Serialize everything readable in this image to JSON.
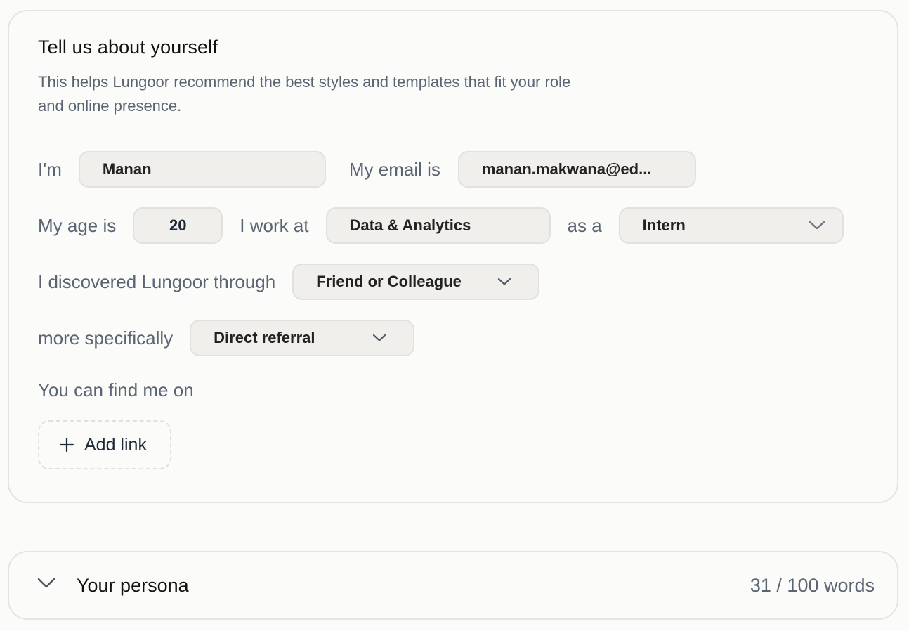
{
  "about": {
    "title": "Tell us about yourself",
    "description": "This helps Lungoor recommend the best styles and templates that fit your role and online presence.",
    "name_label": "I'm",
    "name_value": "Manan",
    "email_label": "My email is",
    "email_value": "manan.makwana@ed...",
    "age_label": "My age is",
    "age_value": "20",
    "work_label": "I work at",
    "work_value": "Data & Analytics",
    "role_label": "as a",
    "role_value": "Intern",
    "discover_label": "I discovered Lungoor through",
    "discover_value": "Friend or Colleague",
    "specific_label": "more specifically",
    "specific_value": "Direct referral",
    "find_label": "You can find me on",
    "add_link_label": "Add link"
  },
  "persona": {
    "title": "Your persona",
    "word_count": "31 / 100 words"
  },
  "icons": {
    "dropdown": "chevron-down-icon",
    "add": "plus-icon",
    "collapse": "chevron-down-icon"
  },
  "colors": {
    "label": "#5b6472",
    "field_bg": "#f0efec",
    "border": "#e4e4e0"
  }
}
